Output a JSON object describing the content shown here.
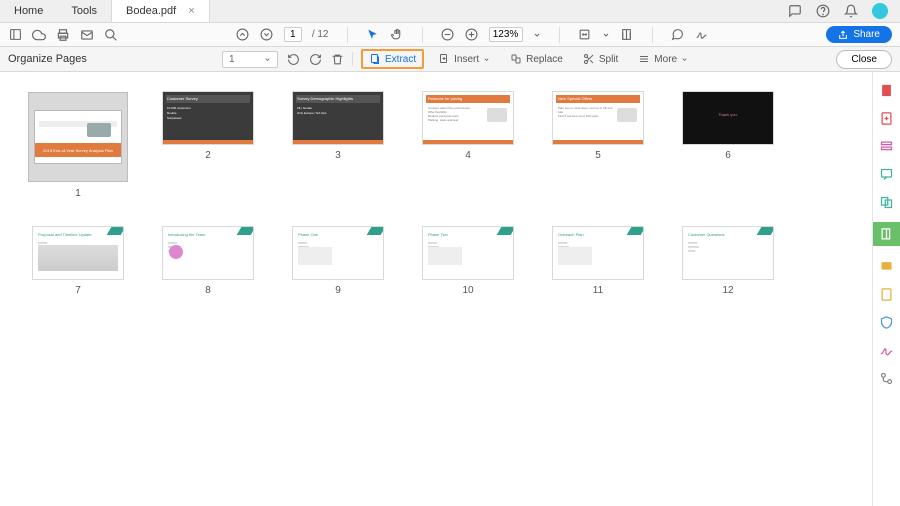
{
  "topbar": {
    "home": "Home",
    "tools": "Tools",
    "filename": "Bodea.pdf",
    "icons": {
      "chat": "chat-icon",
      "help": "help-icon",
      "notif": "notif-icon",
      "avatar": "avatar-icon"
    }
  },
  "toolbar": {
    "page_current": "1",
    "page_total": "12",
    "zoom": "123%",
    "share_label": "Share"
  },
  "subtoolbar": {
    "title": "Organize Pages",
    "page_indicator": "1",
    "extract": "Extract",
    "insert": "Insert",
    "replace": "Replace",
    "split": "Split",
    "more": "More",
    "close": "Close"
  },
  "pages": {
    "count": 12,
    "labels": [
      "1",
      "2",
      "3",
      "4",
      "5",
      "6",
      "7",
      "8",
      "9",
      "10",
      "11",
      "12"
    ],
    "thumbs": [
      {
        "kind": "cover",
        "title": "2015 End-of-Year Survey Analysis Plan"
      },
      {
        "kind": "dark_band",
        "title": "Customer Survey",
        "body": "10,000 customers\\nDouble\\nSurpassed"
      },
      {
        "kind": "dark_band",
        "title": "Survey Demographic Highlights",
        "body": "18+ female\\nOnly Europe / NA Ops"
      },
      {
        "kind": "light_band",
        "title": "Reasons for joining",
        "body": "Concern about the environment\\nOffer flexibility\\nReduce personal costs\\nParking, wear-and-tear"
      },
      {
        "kind": "light_band",
        "title": "New Special Offers",
        "body": "Plan two or more days, rent up to 3K one rate\\nFirst 5 are free up to 100 each"
      },
      {
        "kind": "black",
        "title": "Thank you."
      },
      {
        "kind": "white_accent",
        "title": "Proposal and Timeline Update"
      },
      {
        "kind": "white_accent",
        "title": "Introducing the Team"
      },
      {
        "kind": "white_accent",
        "title": "Phase One"
      },
      {
        "kind": "white_accent",
        "title": "Phase Two"
      },
      {
        "kind": "white_accent",
        "title": "Outreach Plan"
      },
      {
        "kind": "white_accent",
        "title": "Customer Questions"
      }
    ]
  }
}
